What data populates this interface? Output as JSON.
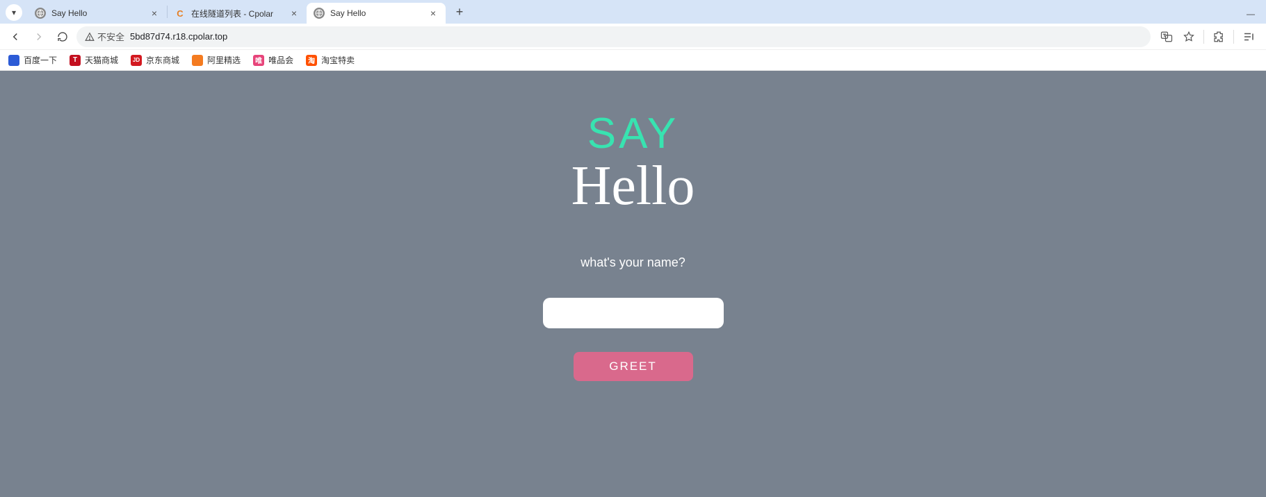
{
  "tabs": [
    {
      "title": "Say Hello",
      "favicon_color": "#888",
      "favicon_letter": ""
    },
    {
      "title": "在线隧道列表 - Cpolar",
      "favicon_color": "#e67e22",
      "favicon_letter": "C"
    },
    {
      "title": "Say Hello",
      "favicon_color": "#888",
      "favicon_letter": ""
    }
  ],
  "active_tab_index": 2,
  "address": {
    "security_label": "不安全",
    "url": "5bd87d74.r18.cpolar.top"
  },
  "bookmarks": [
    {
      "label": "百度一下",
      "icon_bg": "#2c5bd6",
      "icon_letter": ""
    },
    {
      "label": "天猫商城",
      "icon_bg": "#c30f1f",
      "icon_letter": "T"
    },
    {
      "label": "京东商城",
      "icon_bg": "#d31920",
      "icon_letter": "JD"
    },
    {
      "label": "阿里精选",
      "icon_bg": "#f47b20",
      "icon_letter": ""
    },
    {
      "label": "唯品会",
      "icon_bg": "#e7447a",
      "icon_letter": "唯"
    },
    {
      "label": "淘宝特卖",
      "icon_bg": "#ff5000",
      "icon_letter": "淘"
    }
  ],
  "page": {
    "heading_line1": "SAY",
    "heading_line2": "Hello",
    "prompt": "what's your name?",
    "input_value": "",
    "button_label": "GREET"
  },
  "colors": {
    "accent_green": "#38e3b0",
    "button_pink": "#d9698c",
    "page_bg": "#78828f"
  }
}
